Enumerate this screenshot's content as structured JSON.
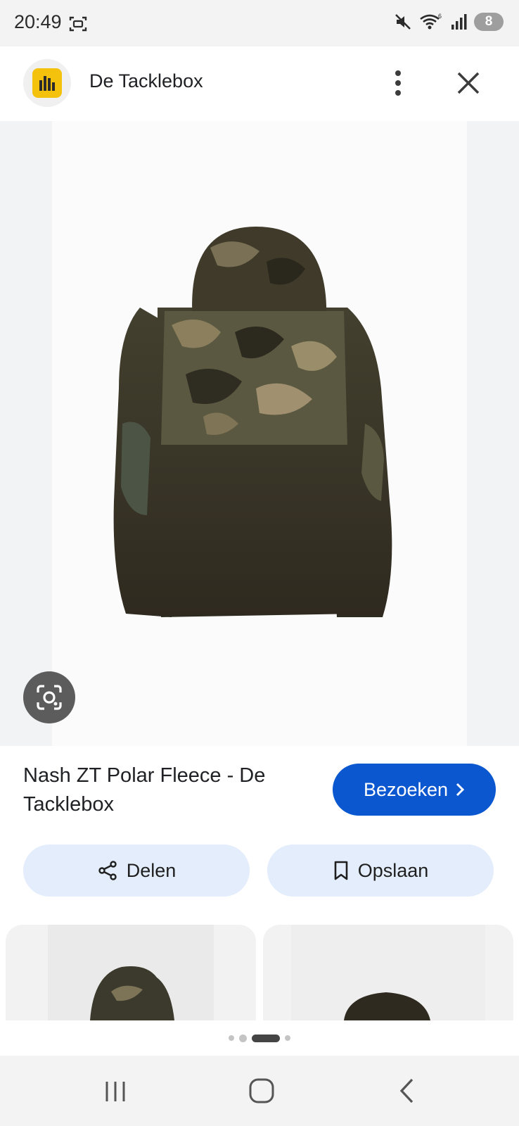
{
  "status_bar": {
    "time": "20:49",
    "battery": "8",
    "icons": [
      "screenshot-icon",
      "mute-icon",
      "wifi-icon",
      "signal-icon",
      "battery-icon"
    ]
  },
  "header": {
    "site_name": "De Tacklebox",
    "logo": "site-logo",
    "more_icon": "more-vert-icon",
    "close_icon": "close-icon"
  },
  "image": {
    "alt": "Nash ZT Polar Fleece",
    "lens_icon": "lens-icon"
  },
  "result": {
    "title": "Nash ZT Polar Fleece - De Tacklebox",
    "visit_label": "Bezoeken",
    "share_label": "Delen",
    "save_label": "Opslaan"
  },
  "pager": {
    "count": 4,
    "active": 2
  },
  "navbar": {
    "icons": [
      "recents-icon",
      "home-icon",
      "back-icon"
    ]
  },
  "colors": {
    "accent": "#0b57d0",
    "pill_bg": "#e3edfb",
    "logo_yellow": "#f4c20d"
  }
}
